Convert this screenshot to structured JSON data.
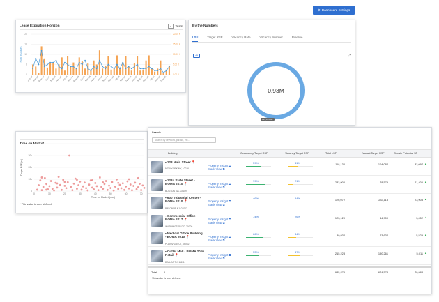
{
  "header": {
    "dashboard_settings_label": "Dashboard Settings",
    "settings_icon": "gear-icon"
  },
  "lease": {
    "title": "Lease Expiration Horizon",
    "years_value": "4",
    "years_label": "Years",
    "colors": {
      "bars": "#f5a352",
      "line": "#4a9ad8"
    },
    "chart_data": {
      "type": "bar",
      "categories": [
        "Jan-22",
        "Feb-22",
        "Mar-22",
        "Apr-22",
        "May-22",
        "Jun-22",
        "Jul-22",
        "Aug-22",
        "Sep-22",
        "Oct-22",
        "Nov-22",
        "Dec-22",
        "Jan-23",
        "Feb-23",
        "Mar-23",
        "Apr-23",
        "May-23",
        "Jun-23",
        "Jul-23",
        "Aug-23",
        "Sep-23",
        "Oct-23",
        "Nov-23",
        "Dec-23",
        "Jan-24",
        "Feb-24",
        "Mar-24",
        "Apr-24",
        "May-24",
        "Jun-24",
        "Jul-24",
        "Aug-24",
        "Sep-24",
        "Oct-24",
        "Nov-24",
        "Dec-24",
        "Jan-25",
        "Feb-25",
        "Mar-25",
        "Apr-25",
        "May-25",
        "Jun-25",
        "Jul-25",
        "Aug-25",
        "Sep-25",
        "Oct-25",
        "Nov-25",
        "Dec-25"
      ],
      "tick_labels": [
        "Jan-22",
        "Mar-22",
        "May-22",
        "Jul-22",
        "Sep-22",
        "Nov-22",
        "Jan-23",
        "Mar-23",
        "May-23",
        "Jul-23",
        "Sep-23",
        "Nov-23",
        "Jan-24",
        "Mar-24",
        "May-24",
        "Jul-24",
        "Sep-24",
        "Nov-24",
        "Jan-25",
        "Mar-25",
        "May-25",
        "Jul-25",
        "Sep-25",
        "Nov-25"
      ],
      "series": [
        {
          "name": "",
          "kind": "bar",
          "axis": "right",
          "values": [
            5000,
            4000,
            1000,
            14000,
            8000,
            3500,
            6000,
            6000,
            3000,
            5000,
            8500,
            2000,
            9000,
            4000,
            6000,
            3000,
            8500,
            6500,
            3000,
            5500,
            2500,
            7000,
            5000,
            12000,
            3000,
            4500,
            9000,
            2500,
            3000,
            9500,
            3500,
            6000,
            9000,
            4000,
            2000,
            5500,
            9000,
            2000,
            2500,
            7000,
            9500,
            3000,
            1500,
            3000,
            7000,
            1000,
            2500,
            4500
          ]
        },
        {
          "name": "",
          "kind": "line",
          "axis": "left",
          "values": [
            3,
            8,
            5,
            12,
            4,
            5,
            6,
            6,
            7,
            4,
            3,
            6,
            5,
            4,
            4,
            3,
            6,
            5,
            7,
            3,
            2,
            4,
            3,
            7,
            4,
            3,
            5,
            4,
            3,
            5,
            3,
            6,
            3,
            4,
            3,
            4,
            5,
            3,
            3,
            3,
            4,
            3,
            2,
            2,
            3,
            1,
            2,
            4
          ]
        }
      ],
      "ylabel_left": "Num of Leases",
      "y_left_ticks": [
        "0",
        "5",
        "10",
        "15",
        "20"
      ],
      "y_right_ticks": [
        "0.00 K",
        "5.00 K",
        "10.00 K",
        "15.00 K",
        "20.00 K"
      ],
      "ylim_left": [
        0,
        20
      ],
      "ylim_right": [
        0,
        20000
      ],
      "grid": true
    }
  },
  "numbers": {
    "title": "By the Numbers",
    "tabs": [
      "LSF",
      "Target RSF",
      "Vacancy Rate",
      "Vacancy Number",
      "Pipeline"
    ],
    "active_tab": 0,
    "chip_label": "All",
    "expand_icon": "expand-icon",
    "donut_value": "0.93M",
    "donut_tag": "935,875 SF",
    "donut_color": "#6aa9e3"
  },
  "market": {
    "title": "Time on Market",
    "note": "* This value is user defined.",
    "marker_color": "#e77a7a",
    "chart_data": {
      "type": "scatter",
      "xlabel": "Time on Market (mo.)",
      "ylabel": "Target RSF (sf)",
      "xlim": [
        0,
        72
      ],
      "ylim": [
        0,
        40000
      ],
      "x_ticks": [
        "0",
        "10",
        "20",
        "30",
        "40",
        "50",
        "60",
        "70"
      ],
      "y_ticks": [
        "0",
        "10k",
        "20k",
        "30k",
        "40k"
      ],
      "points": [
        [
          2,
          1200
        ],
        [
          3,
          5000
        ],
        [
          4,
          9000
        ],
        [
          5,
          800
        ],
        [
          6,
          3500
        ],
        [
          7,
          11000
        ],
        [
          8,
          6000
        ],
        [
          9,
          1500
        ],
        [
          10,
          4200
        ],
        [
          11,
          8500
        ],
        [
          12,
          2000
        ],
        [
          13,
          600
        ],
        [
          14,
          7000
        ],
        [
          15,
          3000
        ],
        [
          16,
          12000
        ],
        [
          17,
          5200
        ],
        [
          18,
          1000
        ],
        [
          19,
          9500
        ],
        [
          20,
          4500
        ],
        [
          21,
          2500
        ],
        [
          22,
          7500
        ],
        [
          23,
          30000
        ],
        [
          24,
          3600
        ],
        [
          25,
          800
        ],
        [
          26,
          6300
        ],
        [
          27,
          10500
        ],
        [
          28,
          2000
        ],
        [
          29,
          5000
        ],
        [
          30,
          8000
        ],
        [
          31,
          1200
        ],
        [
          32,
          4000
        ],
        [
          33,
          7200
        ],
        [
          34,
          2500
        ],
        [
          35,
          600
        ],
        [
          36,
          5500
        ],
        [
          37,
          9000
        ],
        [
          38,
          3000
        ],
        [
          39,
          1500
        ],
        [
          40,
          6800
        ],
        [
          41,
          4200
        ],
        [
          42,
          800
        ],
        [
          43,
          11500
        ],
        [
          44,
          3500
        ],
        [
          45,
          2000
        ],
        [
          46,
          6000
        ],
        [
          47,
          8500
        ],
        [
          48,
          1000
        ],
        [
          49,
          4600
        ],
        [
          50,
          2600
        ],
        [
          51,
          7600
        ],
        [
          52,
          500
        ],
        [
          53,
          3800
        ],
        [
          54,
          9800
        ],
        [
          55,
          1800
        ],
        [
          56,
          5300
        ],
        [
          57,
          2400
        ],
        [
          58,
          6600
        ],
        [
          59,
          1000
        ],
        [
          60,
          3900
        ],
        [
          61,
          8200
        ],
        [
          62,
          2200
        ],
        [
          63,
          5600
        ],
        [
          64,
          700
        ],
        [
          65,
          4400
        ],
        [
          66,
          7100
        ],
        [
          67,
          1600
        ],
        [
          68,
          3300
        ],
        [
          69,
          6200
        ],
        [
          70,
          900
        ],
        [
          71,
          4800
        ],
        [
          72,
          2700
        ],
        [
          15,
          6500
        ],
        [
          28,
          9500
        ],
        [
          45,
          7400
        ],
        [
          55,
          6900
        ],
        [
          8,
          1200
        ],
        [
          62,
          10000
        ],
        [
          38,
          9200
        ],
        [
          20,
          7800
        ],
        [
          5,
          11500
        ],
        [
          68,
          11000
        ]
      ]
    }
  },
  "table": {
    "search_label": "Search",
    "search_placeholder": "Search by keyword, phrase, etc...",
    "columns": [
      "Building",
      "Occupancy Target RSF",
      "Vacancy Target RSF",
      "Total LSF",
      "Vacant Target RSF",
      "Growth Potential SF"
    ],
    "rows": [
      {
        "name": "123 Main Street",
        "address": "NEW YORK NY, 10016",
        "insight": "Property Insight",
        "stack": "Stack View",
        "occ_pct": "59%",
        "occ_val": 59,
        "vac_pct": "41%",
        "vac_val": 41,
        "total_lsf": "118,130",
        "vacant_rsf": "104,084",
        "growth": "32,097"
      },
      {
        "name": "1234 State Street - BOMA 2010",
        "address": "BOSTON MA, 02109",
        "insight": "Property Insight",
        "stack": "Stack View",
        "occ_pct": "79%",
        "occ_val": 79,
        "vac_pct": "21%",
        "vac_val": 21,
        "total_lsf": "282,900",
        "vacant_rsf": "78,579",
        "growth": "11,406"
      },
      {
        "name": "600 Industrial Center - BOMA 2010",
        "address": "BAYONNE NJ, 07002",
        "insight": "Property Insight",
        "stack": "Stack View",
        "occ_pct": "46%",
        "occ_val": 46,
        "vac_pct": "54%",
        "vac_val": 54,
        "total_lsf": "176,072",
        "vacant_rsf": "233,115",
        "growth": "23,905"
      },
      {
        "name": "Commercial Office - BOMA 2017",
        "address": "WASHINGTON DC, 20000",
        "insight": "Property Insight",
        "stack": "Stack View",
        "occ_pct": "74%",
        "occ_val": 74,
        "vac_pct": "26%",
        "vac_val": 26,
        "total_lsf": "123,120",
        "vacant_rsf": "44,900",
        "growth": "3,052"
      },
      {
        "name": "Medical Office Building - BOMA 2010",
        "address": "PLAINVILLE CT, 06062",
        "insight": "Property Insight",
        "stack": "Stack View",
        "occ_pct": "66%",
        "occ_val": 66,
        "vac_pct": "34%",
        "vac_val": 34,
        "total_lsf": "39,932",
        "vacant_rsf": "23,634",
        "growth": "5,529"
      },
      {
        "name": "Outlet Mall - BOMA 2010 Retail",
        "address": "DALLAS TX, 11111",
        "insight": "Property Insight",
        "stack": "Stack View",
        "occ_pct": "53%",
        "occ_val": 53,
        "vac_pct": "47%",
        "vac_val": 47,
        "total_lsf": "215,228",
        "vacant_rsf": "190,261",
        "growth": "5,011"
      }
    ],
    "footer": {
      "label": "Total:",
      "count": "6",
      "total_lsf": "935,875",
      "vacant_rsf": "674,573",
      "growth": "79,988"
    },
    "note": "This value is user defined.",
    "colors": {
      "occ_bar": "#3cb371",
      "vac_bar": "#f2c230",
      "link": "#2f6fd0",
      "growth_up": "#2ea84f"
    }
  }
}
